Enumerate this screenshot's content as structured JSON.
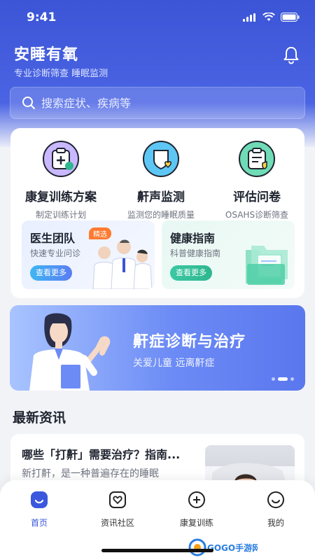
{
  "status": {
    "time": "9:41"
  },
  "header": {
    "title": "安睡有氧",
    "subtitle": "专业诊断筛查  睡眠监测"
  },
  "search": {
    "placeholder": "搜索症状、疾病等"
  },
  "features": [
    {
      "title": "康复训练方案",
      "subtitle": "制定训练计划",
      "icon": "clipboard-plus-icon"
    },
    {
      "title": "鼾声监测",
      "subtitle": "监测您的睡眠质量",
      "icon": "shield-heart-icon"
    },
    {
      "title": "评估问卷",
      "subtitle": "OSAHS诊断筛查",
      "icon": "questionnaire-icon"
    }
  ],
  "tiles": {
    "doctor": {
      "title": "医生团队",
      "badge": "精选",
      "subtitle": "快速专业问诊",
      "button": "查看更多"
    },
    "guide": {
      "title": "健康指南",
      "subtitle": "科普健康指南",
      "button": "查看更多"
    }
  },
  "banner": {
    "title": "鼾症诊断与治疗",
    "subtitle": "关爱儿童 远离鼾症"
  },
  "news_section": {
    "title": "最新资讯"
  },
  "news": [
    {
      "title": "哪些「打鼾」需要治疗？指南...",
      "excerpt": "新打鼾，是一种普遍存在的睡眠"
    }
  ],
  "tabbar": [
    {
      "label": "首页",
      "icon": "home-face-icon",
      "active": true
    },
    {
      "label": "资讯社区",
      "icon": "heart-box-icon",
      "active": false
    },
    {
      "label": "康复训练",
      "icon": "plus-circle-icon",
      "active": false
    },
    {
      "label": "我的",
      "icon": "smile-icon",
      "active": false
    }
  ],
  "watermark": "GOGO手游网",
  "colors": {
    "primary": "#3b55d6",
    "accent_orange": "#ff7a2f",
    "green": "#2fb78f"
  }
}
